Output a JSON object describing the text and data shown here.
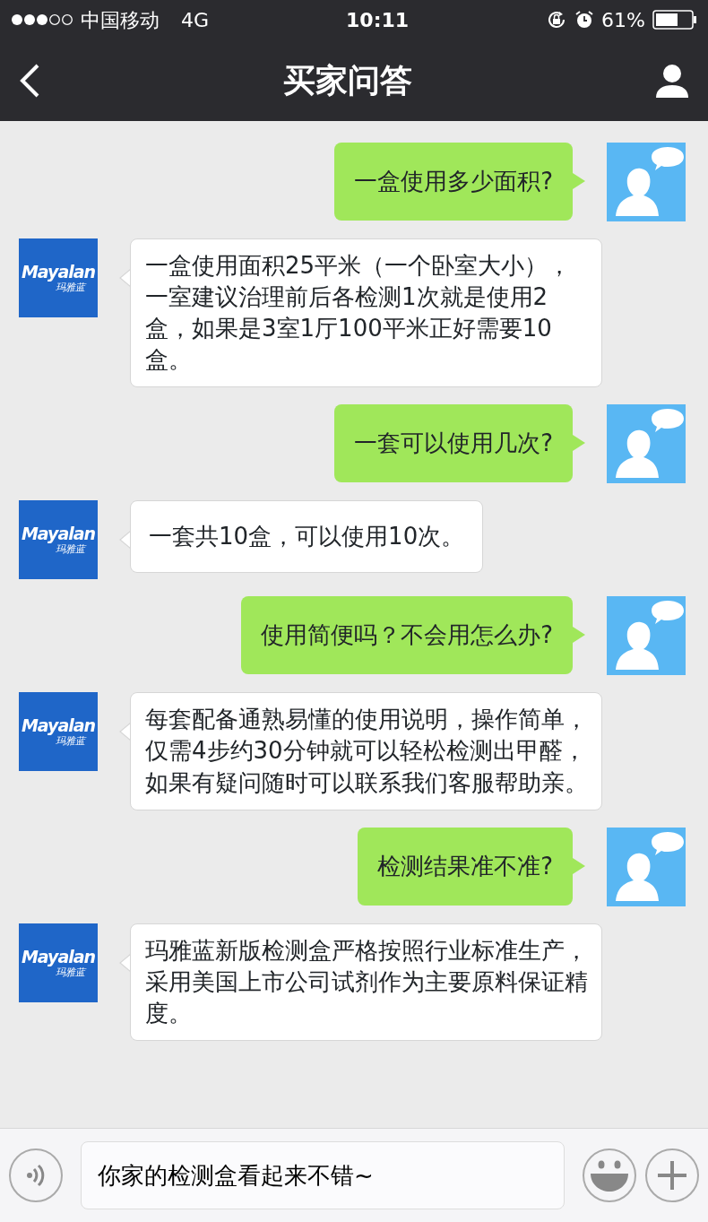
{
  "status_bar": {
    "carrier": "中国移动",
    "network": "4G",
    "time": "10:11",
    "battery": "61%"
  },
  "header": {
    "title": "买家问答"
  },
  "messages": [
    {
      "kind": "question",
      "text": "一盒使用多少面积?"
    },
    {
      "kind": "answer",
      "text": "一盒使用面积25平米（一个卧室大小），一室建议治理前后各检测1次就是使用2盒，如果是3室1厅100平米正好需要10盒。",
      "logo": "Mayalan",
      "logo_sub": "玛雅蓝"
    },
    {
      "kind": "question",
      "text": "一套可以使用几次?"
    },
    {
      "kind": "answer",
      "text": "一套共10盒，可以使用10次。",
      "logo": "Mayalan",
      "logo_sub": "玛雅蓝"
    },
    {
      "kind": "question",
      "text": "使用简便吗？不会用怎么办?"
    },
    {
      "kind": "answer",
      "text": "每套配备通熟易懂的使用说明，操作简单，仅需4步约30分钟就可以轻松检测出甲醛，如果有疑问随时可以联系我们客服帮助亲。",
      "logo": "Mayalan",
      "logo_sub": "玛雅蓝"
    },
    {
      "kind": "question",
      "text": "检测结果准不准?"
    },
    {
      "kind": "answer",
      "text": "玛雅蓝新版检测盒严格按照行业标准生产，采用美国上市公司试剂作为主要原料保证精度。",
      "logo": "Mayalan",
      "logo_sub": "玛雅蓝"
    }
  ],
  "input_bar": {
    "value": "你家的检测盒看起来不错~"
  }
}
